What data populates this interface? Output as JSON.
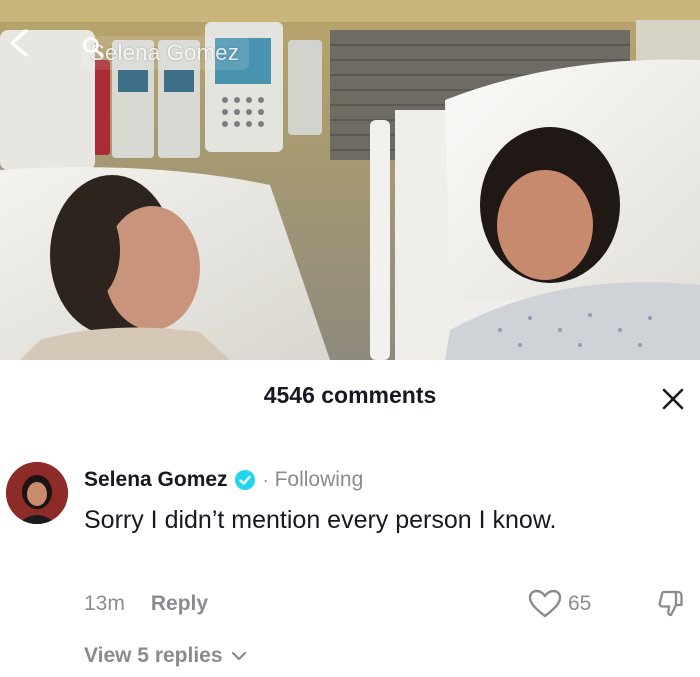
{
  "header": {
    "search_text": "Selena Gomez",
    "icons": {
      "back": "chevron-left-icon",
      "search": "search-icon"
    }
  },
  "photo": {
    "description_icon": "hospital-photo"
  },
  "comments": {
    "count_label": "4546 comments",
    "close_icon": "close-icon",
    "items": [
      {
        "username": "Selena Gomez",
        "verified": true,
        "separator": "·",
        "follow_status": "Following",
        "text": "Sorry I didn’t mention every person I know.",
        "timestamp": "13m",
        "reply_label": "Reply",
        "like_count": "65",
        "view_replies_label": "View 5 replies"
      }
    ]
  },
  "colors": {
    "text_primary": "#161823",
    "text_secondary": "#8a8b91",
    "verified_blue": "#20d5ec"
  }
}
